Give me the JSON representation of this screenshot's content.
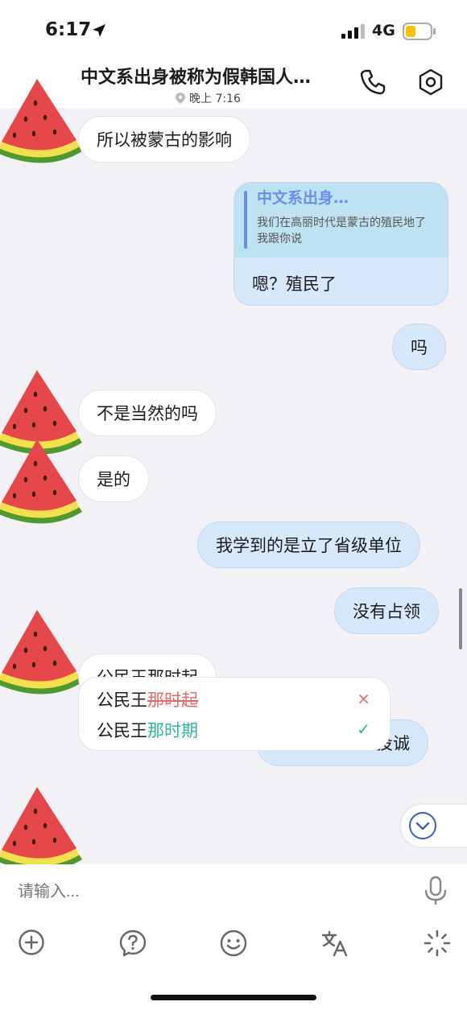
{
  "status_bar": {
    "time": "6:17",
    "network": "4G"
  },
  "header": {
    "title": "中文系出身被称为假韩国人…",
    "subtitle": "晚上 7:16"
  },
  "messages": {
    "m1": "所以被蒙古的影响",
    "reply": {
      "quote_title": "中文系出身…",
      "quote_text": "我们在高丽时代是蒙古的殖民地了 我跟你说",
      "text": "嗯？殖民了"
    },
    "m3": "吗",
    "m4": "不是当然的吗",
    "m5": "是的",
    "m6": "我学到的是立了省级单位",
    "m7": "没有占领",
    "m8": "公民王那时起",
    "m9": "因为朝鲜主动投诚"
  },
  "correction": {
    "wrong_prefix": "公民王",
    "wrong_part": "那时起",
    "right_prefix": "公民王",
    "right_part": "那时期",
    "wrong_mark": "×",
    "right_mark": "✓"
  },
  "input": {
    "placeholder": "请输入..."
  },
  "icons": [
    "location-arrow-icon",
    "signal-icon",
    "battery-icon",
    "phone-icon",
    "settings-icon",
    "location-pin-icon",
    "watermelon-avatar",
    "chevron-down-icon",
    "mic-icon",
    "plus-icon",
    "question-icon",
    "emoji-icon",
    "translate-icon",
    "sparkle-icon"
  ],
  "colors": {
    "outgoing_bubble": "#d8e8fb",
    "incoming_bubble": "#ffffff",
    "quote_accent": "#6a8ee8",
    "wrong": "#e26a6a",
    "right": "#2ab79b",
    "battery": "#f5c400"
  }
}
